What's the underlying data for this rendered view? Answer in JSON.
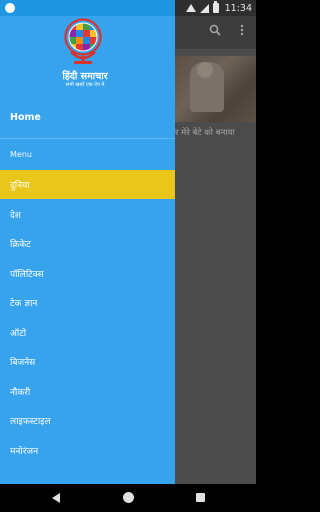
{
  "status_bar": {
    "time": "11:34"
  },
  "background_app": {
    "headline": "र मेरे बेटे को बनाया",
    "icons": [
      "search-icon",
      "more-vert-icon"
    ]
  },
  "drawer": {
    "app_title": "हिंदी समाचार",
    "app_tagline": "सभी खबरें एक ऐप में",
    "home_label": "Home",
    "menu_section_label": "Menu",
    "items": [
      {
        "label": "दुनिया",
        "active": true
      },
      {
        "label": "देश",
        "active": false
      },
      {
        "label": "क्रिकेट",
        "active": false
      },
      {
        "label": "पॉलिटिक्स",
        "active": false
      },
      {
        "label": "टेक ज्ञान",
        "active": false
      },
      {
        "label": "ऑटो",
        "active": false
      },
      {
        "label": "बिजनेस",
        "active": false
      },
      {
        "label": "नौकरी",
        "active": false
      },
      {
        "label": "लाइफस्टाइल",
        "active": false
      },
      {
        "label": "मनोरंजन",
        "active": false
      }
    ]
  },
  "colors": {
    "drawer_bg": "#36a3ec",
    "active_item": "#e8c71a",
    "status_bar_drawer": "#2196e0"
  }
}
